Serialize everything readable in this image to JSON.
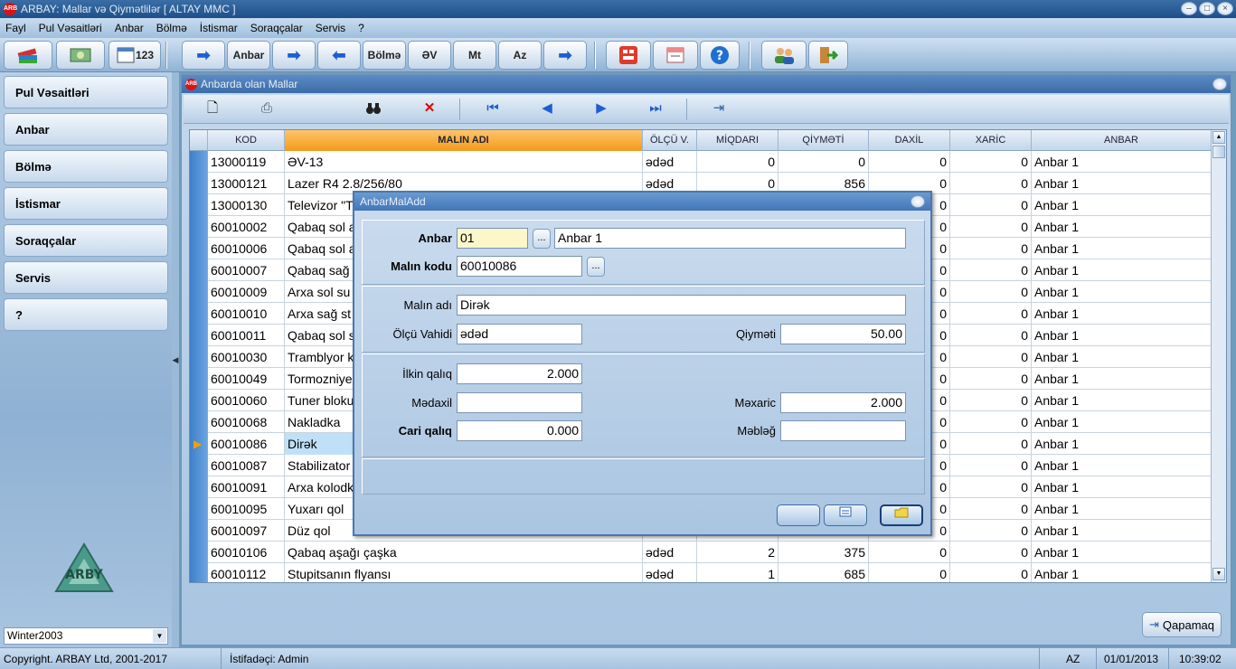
{
  "window": {
    "title": "ARBAY: Mallar və Qiymətlilər [ ALTAY MMC ]",
    "app_icon": "ARB"
  },
  "menu": [
    "Fayl",
    "Pul Vəsaitləri",
    "Anbar",
    "Bölmə",
    "İstismar",
    "Soraqçalar",
    "Servis",
    "?"
  ],
  "toolbar": {
    "btn123": "123",
    "anbar": "Anbar",
    "bolme": "Bölmə",
    "ev": "ƏV",
    "mt": "Mt",
    "az": "Az"
  },
  "sidebar": {
    "items": [
      "Pul Vəsaitləri",
      "Anbar",
      "Bölmə",
      "İstismar",
      "Soraqçalar",
      "Servis",
      "?"
    ],
    "logo": "ARBY",
    "season": "Winter2003"
  },
  "child_window": {
    "title": "Anbarda olan Mallar",
    "icon": "ARB"
  },
  "grid": {
    "columns": [
      "KOD",
      "MALIN ADI",
      "ÖLÇÜ V.",
      "MİQDARI",
      "QİYMƏTİ",
      "DAXİL",
      "XARİC",
      "ANBAR"
    ],
    "rows": [
      [
        "13000119",
        "ƏV-13",
        "ədəd",
        "0",
        "0",
        "0",
        "0",
        "Anbar 1"
      ],
      [
        "13000121",
        "Lazer R4 2.8/256/80",
        "ədəd",
        "0",
        "856",
        "0",
        "0",
        "Anbar 1"
      ],
      [
        "13000130",
        "Televizor \"T",
        "",
        "",
        "",
        "0",
        "0",
        "Anbar 1"
      ],
      [
        "60010002",
        "Qabaq sol a",
        "",
        "",
        "",
        "0",
        "0",
        "Anbar 1"
      ],
      [
        "60010006",
        "Qabaq sol a",
        "",
        "",
        "",
        "0",
        "0",
        "Anbar 1"
      ],
      [
        "60010007",
        "Qabaq sağ",
        "",
        "",
        "",
        "0",
        "0",
        "Anbar 1"
      ],
      [
        "60010009",
        "Arxa sol su",
        "",
        "",
        "",
        "0",
        "0",
        "Anbar 1"
      ],
      [
        "60010010",
        "Arxa sağ st",
        "",
        "",
        "",
        "0",
        "0",
        "Anbar 1"
      ],
      [
        "60010011",
        "Qabaq sol s",
        "",
        "",
        "",
        "0",
        "0",
        "Anbar 1"
      ],
      [
        "60010030",
        "Tramblyor k",
        "",
        "",
        "",
        "0",
        "0",
        "Anbar 1"
      ],
      [
        "60010049",
        "Tormozniye",
        "",
        "",
        "",
        "0",
        "0",
        "Anbar 1"
      ],
      [
        "60010060",
        "Tuner bloku",
        "",
        "",
        "",
        "0",
        "0",
        "Anbar 1"
      ],
      [
        "60010068",
        "Nakladka",
        "",
        "",
        "",
        "0",
        "0",
        "Anbar 1"
      ],
      [
        "60010086",
        "Dirək",
        "",
        "",
        "",
        "0",
        "0",
        "Anbar 1"
      ],
      [
        "60010087",
        "Stabilizator",
        "",
        "",
        "",
        "0",
        "0",
        "Anbar 1"
      ],
      [
        "60010091",
        "Arxa kolodk",
        "",
        "",
        "",
        "0",
        "0",
        "Anbar 1"
      ],
      [
        "60010095",
        "Yuxarı qol",
        "",
        "",
        "",
        "0",
        "0",
        "Anbar 1"
      ],
      [
        "60010097",
        "Düz qol",
        "",
        "",
        "",
        "0",
        "0",
        "Anbar 1"
      ],
      [
        "60010106",
        "Qabaq aşağı çaşka",
        "ədəd",
        "2",
        "375",
        "0",
        "0",
        "Anbar 1"
      ],
      [
        "60010112",
        "Stupitsanın flyansı",
        "ədəd",
        "1",
        "685",
        "0",
        "0",
        "Anbar 1"
      ]
    ],
    "selected_row": 13
  },
  "close_button": "Qapamaq",
  "dialog": {
    "title": "AnbarMalAdd",
    "anbar_label": "Anbar",
    "anbar_code": "01",
    "anbar_name": "Anbar 1",
    "kod_label": "Malın kodu",
    "kod_value": "60010086",
    "ad_label": "Malın adı",
    "ad_value": "Dirək",
    "olcu_label": "Ölçü Vahidi",
    "olcu_value": "ədəd",
    "qiymet_label": "Qiyməti",
    "qiymet_value": "50.00",
    "ilkin_label": "İlkin qalıq",
    "ilkin_value": "2.000",
    "medaxil_label": "Mədaxil",
    "medaxil_value": "",
    "mexaric_label": "Məxaric",
    "mexaric_value": "2.000",
    "cari_label": "Cari qalıq",
    "cari_value": "0.000",
    "mebleg_label": "Məbləğ",
    "mebleg_value": "",
    "ellipsis": "..."
  },
  "status": {
    "copyright": "Copyright. ARBAY Ltd, 2001-2017",
    "user": "İstifadəçi: Admin",
    "lang": "AZ",
    "date": "01/01/2013",
    "time": "10:39:02"
  }
}
